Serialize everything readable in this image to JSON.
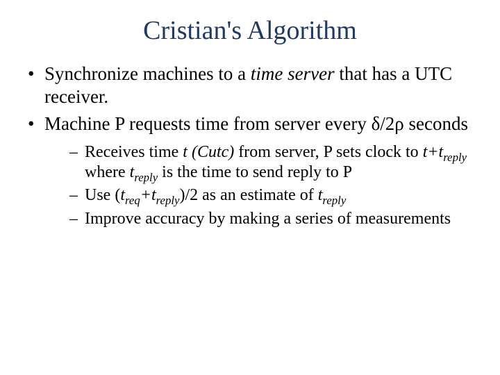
{
  "title": "Cristian's Algorithm",
  "bullets": {
    "b1_pre": "Synchronize machines to a ",
    "b1_em": "time server",
    "b1_post": " that has a UTC receiver.",
    "b2": "Machine P requests time from server every δ/2ρ seconds"
  },
  "sub": {
    "s1_a": "Receives time ",
    "s1_b": "t (Cutc)",
    "s1_c": " from server, P sets clock to ",
    "s1_d": "t+t",
    "s1_reply1": "reply",
    "s1_e": " where ",
    "s1_f": "t",
    "s1_reply2": "reply",
    "s1_g": " is the time to send reply to P",
    "s2_a": "Use (",
    "s2_b": "t",
    "s2_req": "req",
    "s2_c": "+t",
    "s2_reply": "reply",
    "s2_d": ")/2 as an estimate of ",
    "s2_e": "t",
    "s2_reply2": "reply",
    "s3": "Improve accuracy by making a series of measurements"
  }
}
